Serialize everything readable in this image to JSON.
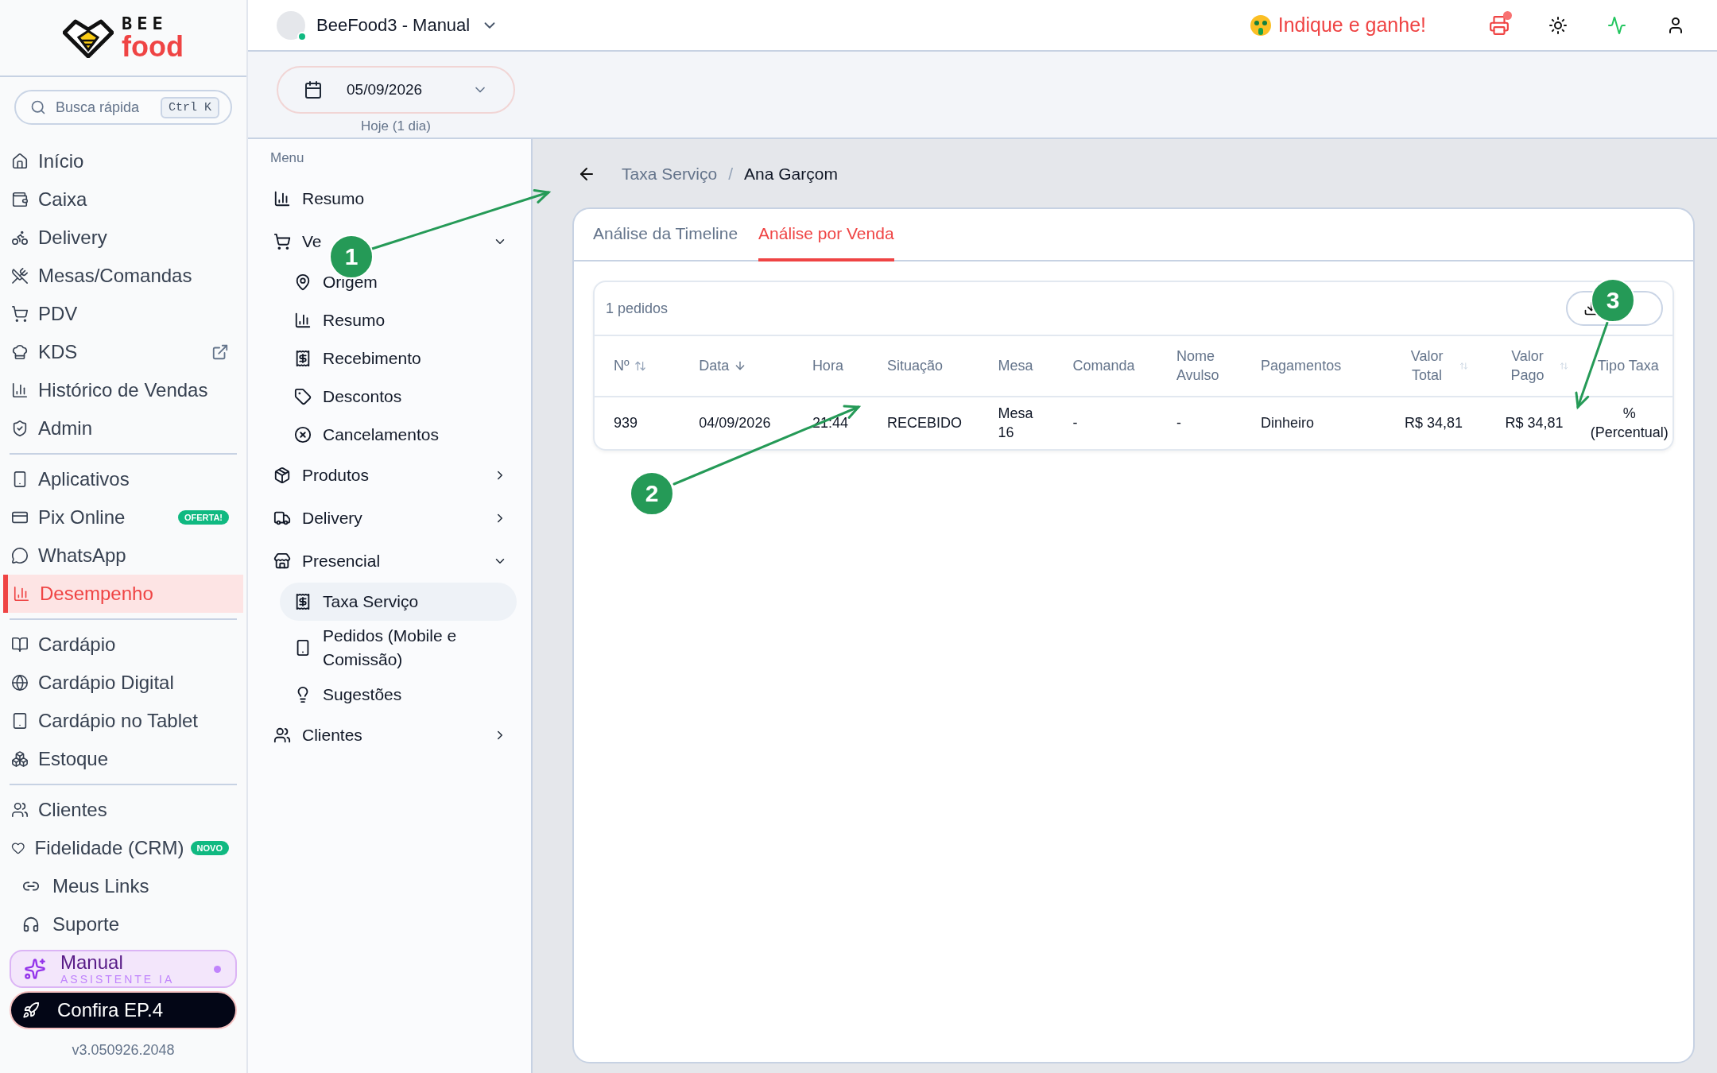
{
  "sidebar": {
    "logo": {
      "top": "BEE",
      "bottom": "food"
    },
    "search": {
      "placeholder": "Busca rápida",
      "shortcut": "Ctrl K"
    },
    "sections": [
      [
        {
          "label": "Início",
          "selected": false,
          "external": false
        },
        {
          "label": "Caixa",
          "selected": false,
          "external": false
        },
        {
          "label": "Delivery",
          "selected": false,
          "external": false
        },
        {
          "label": "Mesas/Comandas",
          "selected": false,
          "external": false
        },
        {
          "label": "PDV",
          "selected": false,
          "external": false
        },
        {
          "label": "KDS",
          "selected": false,
          "external": true
        },
        {
          "label": "Histórico de Vendas",
          "selected": false,
          "external": false
        },
        {
          "label": "Admin",
          "selected": false,
          "external": false
        }
      ],
      [
        {
          "label": "Aplicativos",
          "selected": false,
          "external": false
        },
        {
          "label": "Pix Online",
          "selected": false,
          "external": false,
          "badge": "OFERTA!"
        },
        {
          "label": "WhatsApp",
          "selected": false,
          "external": false
        },
        {
          "label": "Desempenho",
          "selected": true,
          "external": false
        }
      ],
      [
        {
          "label": "Cardápio",
          "selected": false,
          "external": false
        },
        {
          "label": "Cardápio Digital",
          "selected": false,
          "external": false
        },
        {
          "label": "Cardápio no Tablet",
          "selected": false,
          "external": false
        },
        {
          "label": "Estoque",
          "selected": false,
          "external": false
        }
      ],
      [
        {
          "label": "Clientes",
          "selected": false,
          "external": false
        },
        {
          "label": "Fidelidade (CRM)",
          "selected": false,
          "external": false,
          "badge": "NOVO"
        }
      ]
    ],
    "footer_links": [
      "Meus Links",
      "Suporte"
    ],
    "assistant": {
      "title": "Manual",
      "subtitle": "ASSISTENTE IA"
    },
    "promo": "Confira EP.4",
    "version": "v3.050926.2048"
  },
  "topbar": {
    "store": {
      "name": "BeeFood3 - Manual",
      "online": true
    },
    "referral": "Indique e ganhe!",
    "printer_alert": true
  },
  "date_picker": {
    "value": "05/09/2026",
    "hint": "Hoje (1 dia)"
  },
  "menu": {
    "title": "Menu",
    "items": [
      {
        "label": "Resumo",
        "selected": false
      },
      {
        "label": "Ve",
        "expanded": true,
        "selected": false,
        "children": [
          {
            "label": "Origem",
            "selected": false
          },
          {
            "label": "Resumo",
            "selected": false
          },
          {
            "label": "Recebimento",
            "selected": false
          },
          {
            "label": "Descontos",
            "selected": false
          },
          {
            "label": "Cancelamentos",
            "selected": false
          }
        ]
      },
      {
        "label": "Produtos",
        "expanded": false,
        "selected": false
      },
      {
        "label": "Delivery",
        "expanded": false,
        "selected": false
      },
      {
        "label": "Presencial",
        "expanded": true,
        "selected": false,
        "children": [
          {
            "label": "Taxa Serviço",
            "selected": true
          },
          {
            "label": "Pedidos (Mobile e Comissão)",
            "selected": false
          },
          {
            "label": "Sugestões",
            "selected": false
          }
        ]
      },
      {
        "label": "Clientes",
        "expanded": false,
        "selected": false
      }
    ]
  },
  "breadcrumb": {
    "items": [
      "Taxa Serviço",
      "Ana Garçom"
    ],
    "separator": "/"
  },
  "tabs": [
    {
      "label": "Análise da Timeline",
      "selected": false
    },
    {
      "label": "Análise por Venda",
      "selected": true
    }
  ],
  "table": {
    "count": "1 pedidos",
    "columns": [
      {
        "label": "Nº",
        "sorted": false
      },
      {
        "label": "Data",
        "sorted": true
      },
      {
        "label": "Hora"
      },
      {
        "label": "Situação"
      },
      {
        "label": "Mesa"
      },
      {
        "label": "Comanda"
      },
      {
        "label": "Nome Avulso"
      },
      {
        "label": "Pagamentos"
      },
      {
        "label": "Valor Total",
        "sorted": false
      },
      {
        "label": "Valor Pago",
        "sorted": false
      },
      {
        "label": "Tipo Taxa"
      }
    ],
    "rows": [
      [
        "939",
        "04/09/2026",
        "21:44",
        "RECEBIDO",
        "Mesa 16",
        "-",
        "-",
        "Dinheiro",
        "R$ 34,81",
        "R$ 34,81",
        "% (Percentual)"
      ]
    ]
  },
  "annotations": [
    {
      "number": "1"
    },
    {
      "number": "2"
    },
    {
      "number": "3"
    }
  ]
}
